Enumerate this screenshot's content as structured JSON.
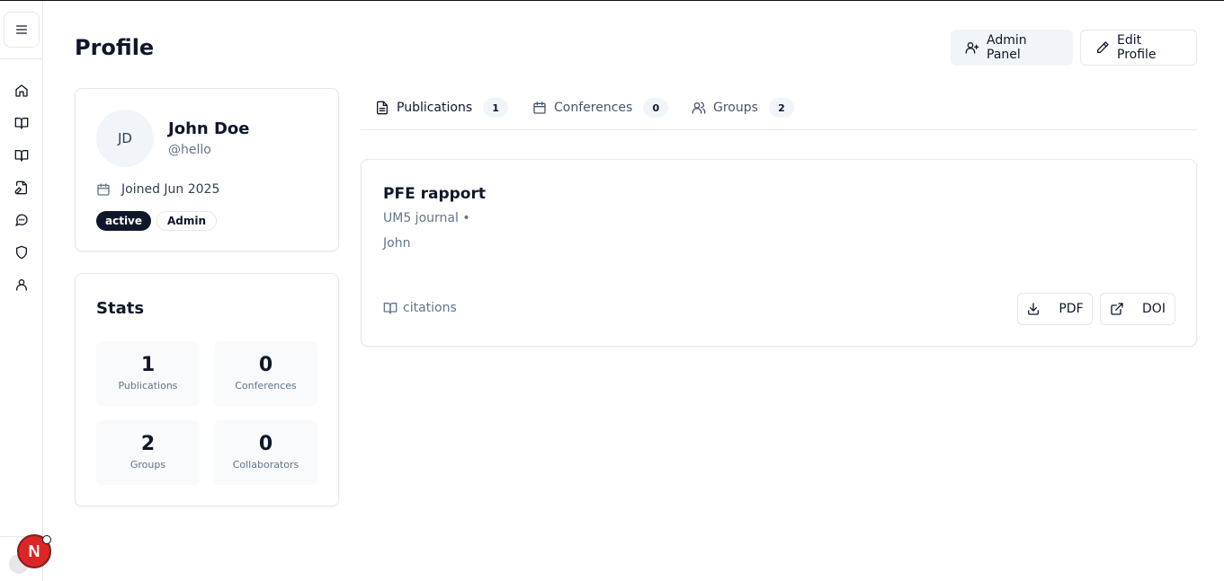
{
  "sidebar": {
    "items": [
      {
        "name": "home-icon"
      },
      {
        "name": "book-open-icon"
      },
      {
        "name": "book-icon"
      },
      {
        "name": "file-edit-icon"
      },
      {
        "name": "message-circle-icon"
      },
      {
        "name": "shield-icon"
      },
      {
        "name": "user-icon"
      }
    ],
    "notification_badge": "N"
  },
  "header": {
    "title": "Profile",
    "admin_panel_label": "Admin Panel",
    "edit_profile_label": "Edit Profile"
  },
  "profile": {
    "initials": "JD",
    "name": "John Doe",
    "handle": "@hello",
    "joined": "Joined Jun 2025",
    "status_badge": "active",
    "role_badge": "Admin"
  },
  "stats": {
    "title": "Stats",
    "items": [
      {
        "value": "1",
        "label": "Publications"
      },
      {
        "value": "0",
        "label": "Conferences"
      },
      {
        "value": "2",
        "label": "Groups"
      },
      {
        "value": "0",
        "label": "Collaborators"
      }
    ]
  },
  "tabs": [
    {
      "label": "Publications",
      "count": "1",
      "icon": "file-text-icon",
      "active": true
    },
    {
      "label": "Conferences",
      "count": "0",
      "icon": "calendar-icon",
      "active": false
    },
    {
      "label": "Groups",
      "count": "2",
      "icon": "users-icon",
      "active": false
    }
  ],
  "publication": {
    "title": "PFE rapport",
    "journal": "UM5 journal •",
    "authors": "John",
    "citations": "citations",
    "pdf_label": "PDF",
    "doi_label": "DOI"
  },
  "colors": {
    "primary": "#0f172a",
    "muted": "#64748b",
    "border": "#e5e7eb",
    "badge_red": "#dc2626"
  }
}
